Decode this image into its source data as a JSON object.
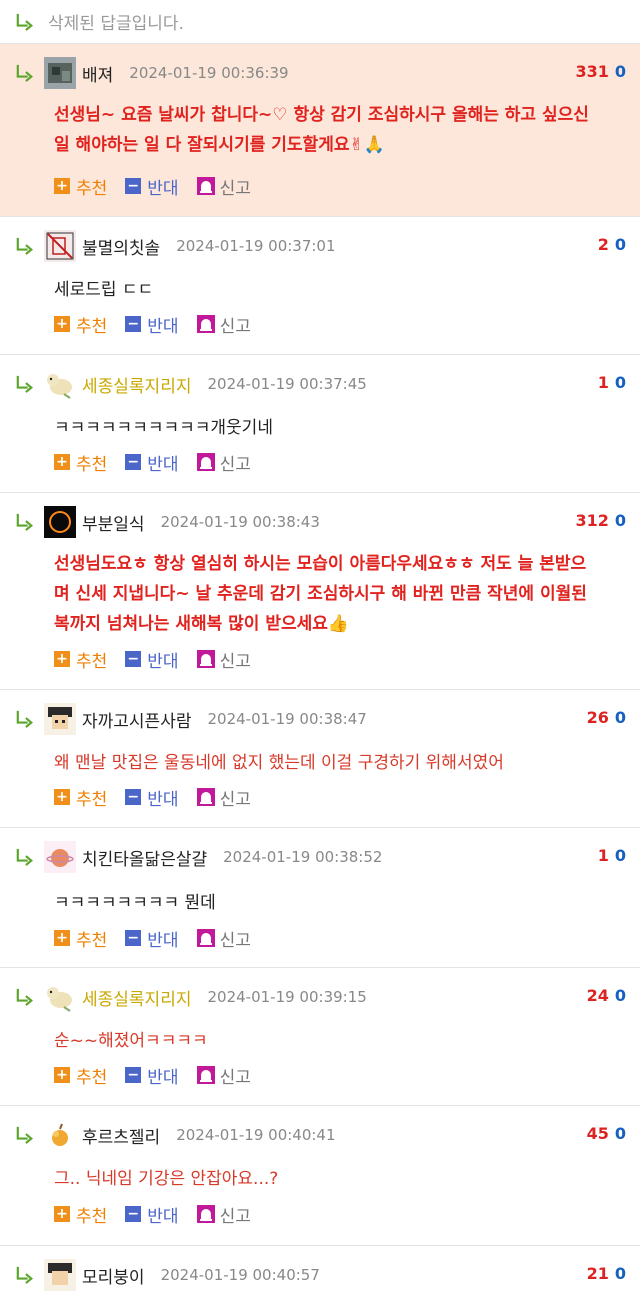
{
  "deleted_text": "삭제된 답글입니다.",
  "actions": {
    "up": "추천",
    "down": "반대",
    "report": "신고"
  },
  "comments": [
    {
      "nick": "배져",
      "date": "2024-01-19 00:36:39",
      "up": "331",
      "down": "0",
      "lines": [
        "선생님~ 요즘 날씨가 찹니다~♡ 항상 감기 조심하시구 올해는 하고 싶으신",
        "일 해야하는 일 다 잘되시기를 기도할게요✌🙏"
      ]
    },
    {
      "nick": "불멸의칫솔",
      "date": "2024-01-19 00:37:01",
      "up": "2",
      "down": "0",
      "lines": [
        "세로드립 ㄷㄷ"
      ]
    },
    {
      "nick": "세종실록지리지",
      "date": "2024-01-19 00:37:45",
      "up": "1",
      "down": "0",
      "lines": [
        "ㅋㅋㅋㅋㅋㅋㅋㅋㅋㅋ개웃기네"
      ]
    },
    {
      "nick": "부분일식",
      "date": "2024-01-19 00:38:43",
      "up": "312",
      "down": "0",
      "lines": [
        "선생님도요ㅎ 항상 열심히 하시는 모습이 아름다우세요ㅎㅎ 저도 늘 본받으",
        "며 신세 지냅니다~ 날 추운데 감기 조심하시구 해 바뀐 만큼 작년에 이월된",
        "복까지 넘쳐나는 새해복 많이 받으세요👍"
      ]
    },
    {
      "nick": "자까고시픈사람",
      "date": "2024-01-19 00:38:47",
      "up": "26",
      "down": "0",
      "lines": [
        "왜 맨날 맛집은 울동네에 없지 했는데 이걸 구경하기 위해서였어"
      ]
    },
    {
      "nick": "치킨타올닮은살걀",
      "date": "2024-01-19 00:38:52",
      "up": "1",
      "down": "0",
      "lines": [
        "ㅋㅋㅋㅋㅋㅋㅋㅋ 뭔데"
      ]
    },
    {
      "nick": "세종실록지리지",
      "date": "2024-01-19 00:39:15",
      "up": "24",
      "down": "0",
      "lines": [
        "순~~해졌어ㅋㅋㅋㅋ"
      ]
    },
    {
      "nick": "후르츠젤리",
      "date": "2024-01-19 00:40:41",
      "up": "45",
      "down": "0",
      "lines": [
        "그.. 닉네임 기강은 안잡아요...?"
      ]
    },
    {
      "nick": "모리붕이",
      "date": "2024-01-19 00:40:57",
      "up": "21",
      "down": "0",
      "lines": []
    }
  ]
}
